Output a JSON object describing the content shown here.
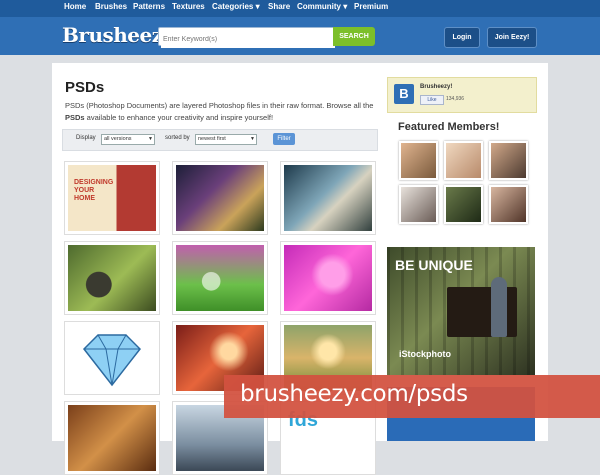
{
  "topnav": {
    "items": [
      {
        "label": "Home"
      },
      {
        "label": "Brushes"
      },
      {
        "label": "Patterns"
      },
      {
        "label": "Textures"
      },
      {
        "label": "Categories ▾"
      },
      {
        "label": "Share"
      },
      {
        "label": "Community ▾"
      },
      {
        "label": "Premium"
      }
    ]
  },
  "header": {
    "logo": "Brusheezy",
    "search": {
      "placeholder": "Enter Keyword(s)",
      "button": "SEARCH"
    },
    "login": "Login",
    "join": "Join Eezy!"
  },
  "main": {
    "title": "PSDs",
    "desc_prefix": "PSDs (Photoshop Documents) are layered Photoshop files in their raw format. Browse all the ",
    "desc_bold": "PSDs",
    "desc_suffix": " available to enhance your creativity and inspire yourself!",
    "filter": {
      "display_label": "Display",
      "display_value": "all versions",
      "sort_label": "sorted by",
      "sort_value": "newest first",
      "button": "Filter"
    },
    "thumbs": [
      {
        "name": "designing-your-home",
        "caption": "DESIGNING YOUR HOME"
      },
      {
        "name": "tree-collage"
      },
      {
        "name": "zebras"
      },
      {
        "name": "bird"
      },
      {
        "name": "bubbles-grass"
      },
      {
        "name": "pink-hearts"
      },
      {
        "name": "diamond"
      },
      {
        "name": "bokeh-lights"
      },
      {
        "name": "flames-field"
      },
      {
        "name": "guitar"
      },
      {
        "name": "dock"
      },
      {
        "name": "fds-logo",
        "caption": "fds"
      }
    ]
  },
  "sidebar": {
    "fb_name": "Brusheezy!",
    "fb_like": "Like",
    "fb_count": "134,936",
    "featured_title": "Featured Members!",
    "ad_title": "BE UNIQUE",
    "ad_brand": "iStockphoto"
  },
  "banner": {
    "text": "brusheezy.com/psds"
  },
  "colors": {
    "nav": "#1f5b9c",
    "header": "#2f6fb5",
    "search_btn": "#7cbf2a",
    "banner": "#d25240"
  }
}
